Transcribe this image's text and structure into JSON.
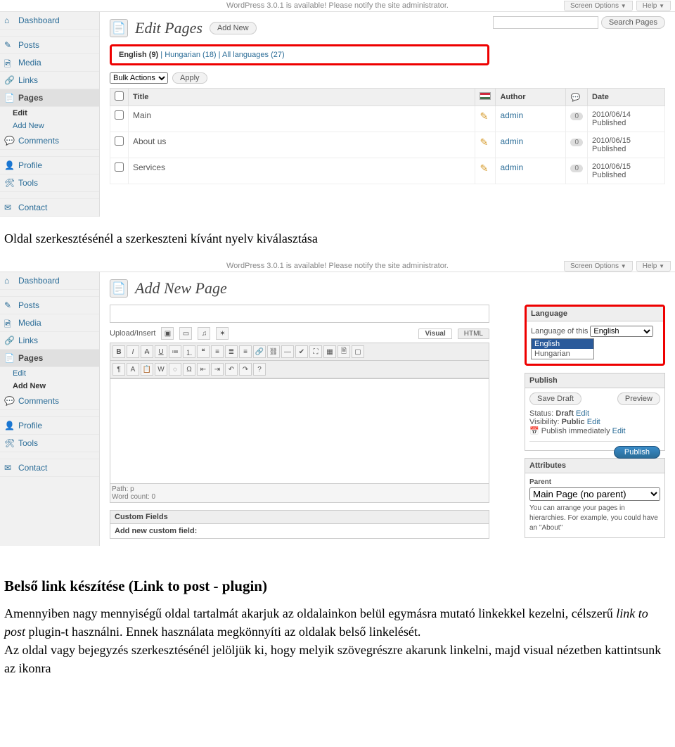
{
  "topbar": {
    "notice": "WordPress 3.0.1 is available! Please notify the site administrator.",
    "screen_options": "Screen Options",
    "help": "Help"
  },
  "sidebar": {
    "dashboard": "Dashboard",
    "posts": "Posts",
    "media": "Media",
    "links": "Links",
    "pages": "Pages",
    "pages_edit": "Edit",
    "pages_addnew": "Add New",
    "comments": "Comments",
    "profile": "Profile",
    "tools": "Tools",
    "contact": "Contact"
  },
  "shot1": {
    "title": "Edit Pages",
    "addnew": "Add New",
    "search_btn": "Search Pages",
    "lang_filter": {
      "english": "English (9)",
      "hungarian": "Hungarian (18)",
      "all": "All languages (27)"
    },
    "bulk_label": "Bulk Actions",
    "apply": "Apply",
    "columns": {
      "title": "Title",
      "author": "Author",
      "date": "Date"
    },
    "rows": [
      {
        "title": "Main",
        "author": "admin",
        "comments": "0",
        "date": "2010/06/14",
        "status": "Published"
      },
      {
        "title": "About us",
        "author": "admin",
        "comments": "0",
        "date": "2010/06/15",
        "status": "Published"
      },
      {
        "title": "Services",
        "author": "admin",
        "comments": "0",
        "date": "2010/06/15",
        "status": "Published"
      }
    ]
  },
  "doc": {
    "caption1": "Oldal szerkesztésénél  a szerkeszteni kívánt nyelv kiválasztása",
    "heading": "Belső link készítése (Link to post - plugin)",
    "para1a": "Amennyiben nagy mennyiségű  oldal tartalmát akarjuk az oldalainkon belül egymásra mutató linkekkel kezelni, célszerű ",
    "para1_em": "link to post",
    "para1b": " plugin-t használni. Ennek használata megkönnyíti az oldalak belső linkelését.",
    "para2": "Az oldal vagy bejegyzés szerkesztésénél jelöljük ki, hogy melyik szövegrészre akarunk linkelni, majd visual nézetben kattintsunk az ikonra"
  },
  "shot2": {
    "title": "Add New Page",
    "upload_label": "Upload/Insert",
    "tab_visual": "Visual",
    "tab_html": "HTML",
    "path": "Path: p",
    "wordcount": "Word count: 0",
    "custom_fields_hd": "Custom Fields",
    "custom_fields_bd": "Add new custom field:",
    "lang": {
      "hd": "Language",
      "label": "Language of this",
      "selected": "English",
      "opt1": "English",
      "opt2": "Hungarian"
    },
    "publish": {
      "hd": "Publish",
      "save_draft": "Save Draft",
      "preview": "Preview",
      "status_lbl": "Status:",
      "status_val": "Draft",
      "vis_lbl": "Visibility:",
      "vis_val": "Public",
      "pub_when": "Publish immediately",
      "edit": "Edit",
      "publish_btn": "Publish"
    },
    "attributes": {
      "hd": "Attributes",
      "parent_lbl": "Parent",
      "parent_val": "Main Page (no parent)",
      "desc": "You can arrange your pages in hierarchies. For example, you could have an \"About\""
    }
  }
}
